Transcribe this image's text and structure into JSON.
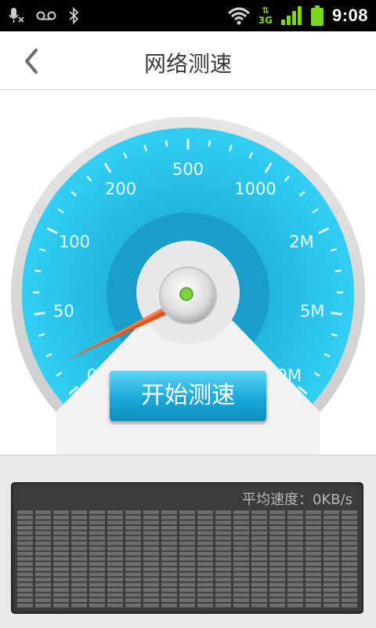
{
  "status_bar": {
    "time": "9:08",
    "network": "3G",
    "icons": [
      "mic-mute-icon",
      "voicemail-icon",
      "bluetooth-icon",
      "wifi-icon",
      "data-arrows-icon",
      "signal-icon",
      "battery-icon"
    ]
  },
  "header": {
    "title": "网络测速",
    "back_icon": "chevron-left-icon"
  },
  "gauge": {
    "scale_labels": [
      "0",
      "50",
      "100",
      "200",
      "500",
      "1000",
      "2M",
      "5M",
      "10M"
    ],
    "needle_value": "0",
    "colors": {
      "dial": "#29c6ec",
      "inner": "#1aa6cf",
      "needle": "#e0561c",
      "hub": "#7fd13b"
    }
  },
  "actions": {
    "start_label": "开始测速"
  },
  "result": {
    "avg_speed_label": "平均速度：0KB/s"
  }
}
